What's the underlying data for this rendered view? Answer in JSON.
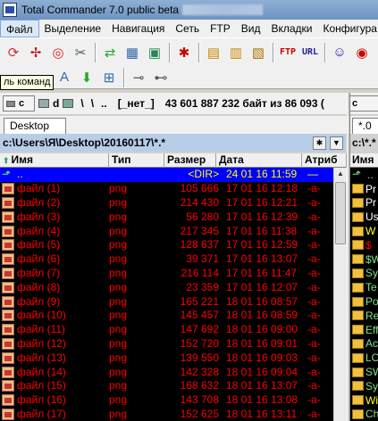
{
  "window": {
    "title": "Total Commander 7.0 public beta"
  },
  "menu": [
    "Файл",
    "Выделение",
    "Навигация",
    "Сеть",
    "FTP",
    "Вид",
    "Вкладки",
    "Конфигура"
  ],
  "toolbar": {
    "ftp_label": "FTP",
    "url_label": "URL",
    "tooltip": "ль команд"
  },
  "drivebar": {
    "left_drive": "c",
    "second_drive": "d",
    "root_label": "\\",
    "parent_label": "..",
    "net_label": "[_нет_]",
    "free_space": "43 601 887 232 байт из 86 093 (",
    "right_drive": "c"
  },
  "left_panel": {
    "tab": "Desktop",
    "path": "c:\\Users\\Я\\Desktop\\20160117\\*.*",
    "columns": {
      "name": "Имя",
      "type": "Тип",
      "size": "Размер",
      "date": "Дата",
      "attr": "Атриб"
    },
    "parent_row": {
      "name": "..",
      "size": "<DIR>",
      "date": "24 01 16 11:59",
      "attr": "—"
    },
    "files": [
      {
        "name": "файл (1)",
        "type": "png",
        "size": "105 666",
        "date": "17 01 16 12:18",
        "attr": "-a-"
      },
      {
        "name": "файл (2)",
        "type": "png",
        "size": "214 430",
        "date": "17 01 16 12:21",
        "attr": "-a-"
      },
      {
        "name": "файл (3)",
        "type": "png",
        "size": "56 280",
        "date": "17 01 16 12:39",
        "attr": "-a-"
      },
      {
        "name": "файл (4)",
        "type": "png",
        "size": "217 345",
        "date": "17 01 16 11:38",
        "attr": "-a-"
      },
      {
        "name": "файл (5)",
        "type": "png",
        "size": "128 637",
        "date": "17 01 16 12:59",
        "attr": "-a-"
      },
      {
        "name": "файл (6)",
        "type": "png",
        "size": "39 371",
        "date": "17 01 16 13:07",
        "attr": "-a-"
      },
      {
        "name": "файл (7)",
        "type": "png",
        "size": "216 114",
        "date": "17 01 16 11:47",
        "attr": "-a-"
      },
      {
        "name": "файл (8)",
        "type": "png",
        "size": "23 359",
        "date": "17 01 16 12:07",
        "attr": "-a-"
      },
      {
        "name": "файл (9)",
        "type": "png",
        "size": "165 221",
        "date": "18 01 16 08:57",
        "attr": "-a-"
      },
      {
        "name": "файл (10)",
        "type": "png",
        "size": "145 457",
        "date": "18 01 16 08:59",
        "attr": "-a-"
      },
      {
        "name": "файл (11)",
        "type": "png",
        "size": "147 692",
        "date": "18 01 16 09:00",
        "attr": "-a-"
      },
      {
        "name": "файл (12)",
        "type": "png",
        "size": "152 720",
        "date": "18 01 16 09:01",
        "attr": "-a-"
      },
      {
        "name": "файл (13)",
        "type": "png",
        "size": "139 550",
        "date": "18 01 16 09:03",
        "attr": "-a-"
      },
      {
        "name": "файл (14)",
        "type": "png",
        "size": "142 328",
        "date": "18 01 16 09:04",
        "attr": "-a-"
      },
      {
        "name": "файл (15)",
        "type": "png",
        "size": "168 632",
        "date": "18 01 16 13:07",
        "attr": "-a-"
      },
      {
        "name": "файл (16)",
        "type": "png",
        "size": "143 708",
        "date": "18 01 16 13:08",
        "attr": "-a-"
      },
      {
        "name": "файл (17)",
        "type": "png",
        "size": "152 625",
        "date": "18 01 16 13:11",
        "attr": "-a-"
      }
    ]
  },
  "right_panel": {
    "tab": "*.0",
    "path": "c:\\*.*",
    "column_name": "Имя",
    "items": [
      "..",
      "Pr",
      "Pr",
      "Us",
      "W",
      "$",
      "$W",
      "Sy",
      "Te",
      "Po",
      "Re",
      "Eff",
      "Ac",
      "LO",
      "SW",
      "Sy",
      "Wi",
      "Ch"
    ]
  },
  "colors": {
    "list_bg": "#000000",
    "file_fg": "#ff0000",
    "selected_bg": "#0000ff",
    "selected_fg": "#ffff00"
  }
}
